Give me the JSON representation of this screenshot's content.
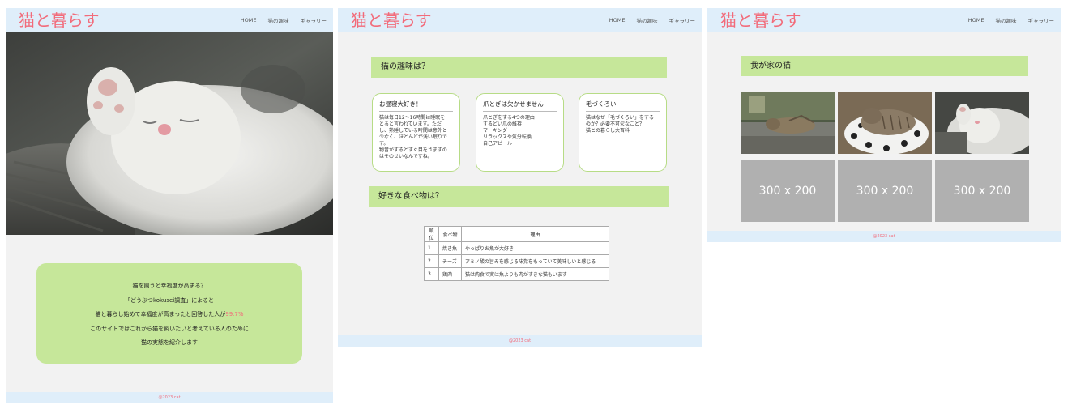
{
  "site": {
    "title": "猫と暮らす",
    "nav": [
      "HOME",
      "猫の趣味",
      "ギャラリー"
    ],
    "footer": "@2023 cat"
  },
  "home": {
    "intro_lines": [
      "猫を飼うと幸福度が高まる？",
      "「どうぶつkokusei調査」によると",
      "猫と暮らし始めて幸福度が高まったと回答した人が",
      "このサイトではこれから猫を飼いたいと考えている人のために",
      "猫の実態を紹介します"
    ],
    "highlight": "99.7%"
  },
  "hobby": {
    "heading": "猫の趣味は？",
    "cards": [
      {
        "title": "お昼寝大好き！",
        "body": "猫は毎日12〜16時間は睡眠を\nとると言われています。ただ\nし、熟睡している時間は意外と\n少なく、ほとんどが浅い眠りで\nす。\n物音がするとすぐ目をさますの\nはそのせいなんですね。"
      },
      {
        "title": "爪とぎは欠かせません",
        "body": "爪とぎをする4つの理由！\nするどい爪の維持\nマーキング\nリラックスや気分転換\n自己アピール"
      },
      {
        "title": "毛づくろい",
        "body": "猫はなぜ「毛づくろい」をする\nのか？必要不可欠なこと？\n猫との暮らし大百科"
      }
    ],
    "food_heading": "好きな食べ物は？",
    "table": {
      "headers": [
        "順位",
        "食べ物",
        "理由"
      ],
      "rows": [
        [
          "1",
          "焼き魚",
          "やっぱりお魚が大好き"
        ],
        [
          "2",
          "チーズ",
          "アミノ酸の旨みを感じる味覚をもっていて美味しいと感じる"
        ],
        [
          "3",
          "鶏肉",
          "猫は肉食で実は魚よりも肉がすきな猫もいます"
        ]
      ]
    }
  },
  "gallery": {
    "heading": "我が家の猫",
    "placeholders": [
      "300 x 200",
      "300 x 200",
      "300 x 200"
    ]
  },
  "colors": {
    "header_bg": "#dfeefa",
    "logo": "#f26b7a",
    "accent_green": "#c6e79a",
    "panel_bg": "#f2f2f2"
  }
}
